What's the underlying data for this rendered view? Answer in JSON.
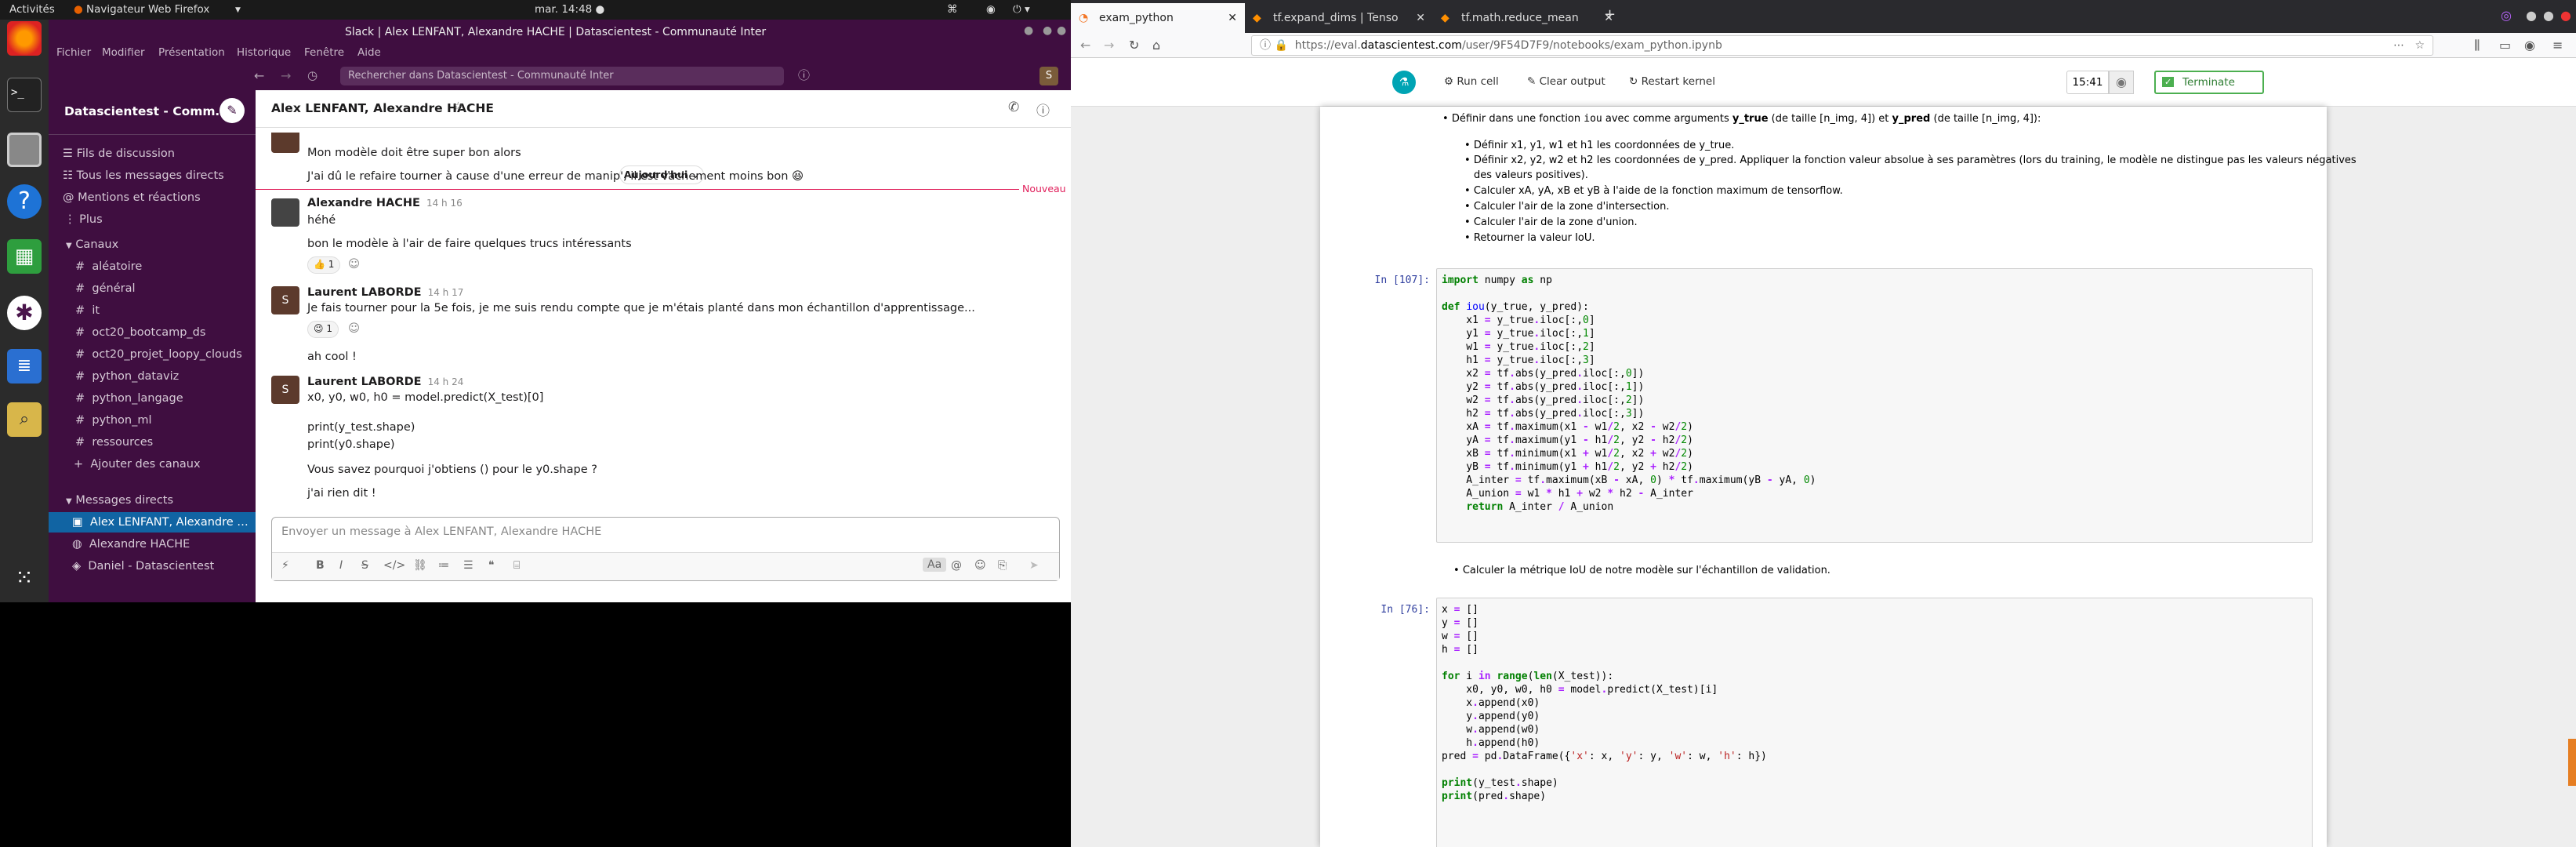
{
  "system": {
    "activities": "Activités",
    "app": "Navigateur Web Firefox",
    "clock": "mar. 14:48 ●"
  },
  "slack": {
    "window_title": "Slack | Alex LENFANT, Alexandre HACHE | Datascientest - Communauté Inter",
    "menu": [
      "Fichier",
      "Modifier",
      "Présentation",
      "Historique",
      "Fenêtre",
      "Aide"
    ],
    "search_placeholder": "Rechercher dans Datascientest - Communauté Inter",
    "workspace": "Datascientest - Comm…",
    "nav": [
      "Fils de discussion",
      "Tous les messages directs",
      "Mentions et réactions",
      "Plus"
    ],
    "channels_header": "Canaux",
    "channels": [
      "aléatoire",
      "général",
      "it",
      "oct20_bootcamp_ds",
      "oct20_projet_loopy_clouds",
      "python_dataviz",
      "python_langage",
      "python_ml",
      "ressources"
    ],
    "add_channels": "Ajouter des canaux",
    "dm_header": "Messages directs",
    "dms": [
      "Alex LENFANT, Alexandre …",
      "Alexandre HACHE",
      "Daniel - Datascientest"
    ],
    "conversation_title": "Alex LENFANT, Alexandre HACHE",
    "date_chip": "Aujourd'hui ⌄",
    "new_label": "Nouveau",
    "messages": [
      {
        "text": "Mon modèle doit être super bon alors"
      },
      {
        "text": "J'ai dû le refaire tourner à cause d'une erreur de manip', il est vachement moins bon 😆"
      },
      {
        "author": "Alexandre HACHE",
        "time": "14 h 16",
        "lines": [
          "héhé",
          "bon le modèle à l'air de faire quelques trucs intéressants"
        ],
        "reaction": "👍 1"
      },
      {
        "author": "Laurent LABORDE",
        "time": "14 h 17",
        "lines": [
          "Je fais tourner pour la 5e fois, je me suis rendu compte que je m'étais planté dans mon échantillon d'apprentissage..."
        ],
        "reaction": "😉 1",
        "after": "ah cool !"
      },
      {
        "author": "Laurent LABORDE",
        "time": "14 h 24",
        "lines": [
          "x0, y0, w0, h0 = model.predict(X_test)[0]",
          "print(y_test.shape)",
          "print(y0.shape)",
          "Vous savez pourquoi j'obtiens () pour le y0.shape ?",
          "j'ai rien dit !"
        ]
      }
    ],
    "composer_placeholder": "Envoyer un message à Alex LENFANT, Alexandre HACHE"
  },
  "firefox": {
    "tabs": [
      "exam_python",
      "tf.expand_dims | Tenso",
      "tf.math.reduce_mean"
    ],
    "url_prefix": "https://eval.",
    "url_domain": "datascientest.com",
    "url_suffix": "/user/9F54D7F9/notebooks/exam_python.ipynb",
    "toolbar": {
      "run": "Run cell",
      "clear": "Clear output",
      "restart": "Restart kernel",
      "timer": "15:41",
      "terminate": "Terminate"
    },
    "md1": {
      "intro_a": "Définir dans une fonction ",
      "intro_code": "iou",
      "intro_b": " avec comme arguments ",
      "intro_c": "y_true",
      "intro_d": " (de taille [n_img, 4]) et ",
      "intro_e": "y_pred",
      "intro_f": " (de taille [n_img, 4]):",
      "b1": "Définir x1, y1, w1 et h1 les coordonnées de y_true.",
      "b2a": "Définir x2, y2, w2 et h2 les coordonnées de y_pred. Appliquer la fonction valeur absolue à ses paramètres (lors du training, le modèle ne distingue pas les valeurs négatives",
      "b2b": "des valeurs positives).",
      "b3": "Calculer xA, yA, xB et yB à l'aide de la fonction maximum de tensorflow.",
      "b4": "Calculer l'air de la zone d'intersection.",
      "b5": "Calculer l'air de la zone d'union.",
      "b6": "Retourner la valeur IoU."
    },
    "cell1_prompt": "In [107]:",
    "md2": "Calculer la métrique IoU de notre modèle sur l'échantillon de validation.",
    "cell2_prompt": "In [76]:"
  }
}
